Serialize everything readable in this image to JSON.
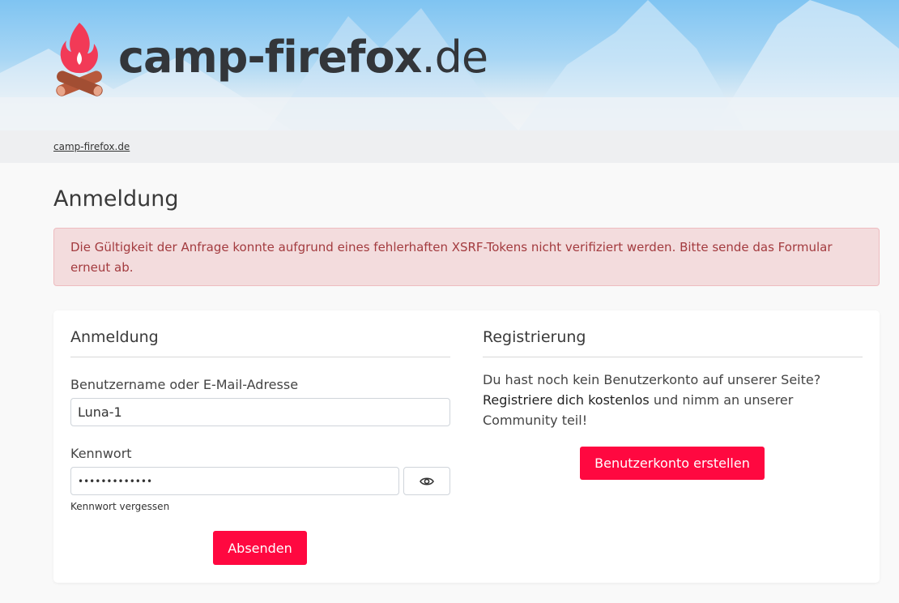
{
  "brand": {
    "name_main": "camp-firefox",
    "name_tld": ".de"
  },
  "breadcrumb": {
    "items": [
      "camp-firefox.de"
    ]
  },
  "page": {
    "title": "Anmeldung"
  },
  "alert": {
    "message": "Die Gültigkeit der Anfrage konnte aufgrund eines fehlerhaften XSRF-Tokens nicht verifiziert werden. Bitte sende das Formular erneut ab."
  },
  "login": {
    "title": "Anmeldung",
    "username_label": "Benutzername oder E-Mail-Adresse",
    "username_value": "Luna-1",
    "password_label": "Kennwort",
    "password_value": "•••••••••••••",
    "show_password_icon": "eye-icon",
    "forgot_link": "Kennwort vergessen",
    "submit_label": "Absenden"
  },
  "register": {
    "title": "Registrierung",
    "text_before": "Du hast noch kein Benutzerkonto auf unserer Seite? ",
    "link_text": "Registriere dich kostenlos",
    "text_after": " und nimm an unserer Community teil!",
    "button_label": "Benutzerkonto erstellen"
  },
  "colors": {
    "accent": "#ff0840",
    "alert_bg": "#f3dcdd",
    "alert_text": "#a33b3f",
    "logo_text": "#33363a",
    "flame": "#f23a57",
    "logs": "#b85a3c"
  }
}
